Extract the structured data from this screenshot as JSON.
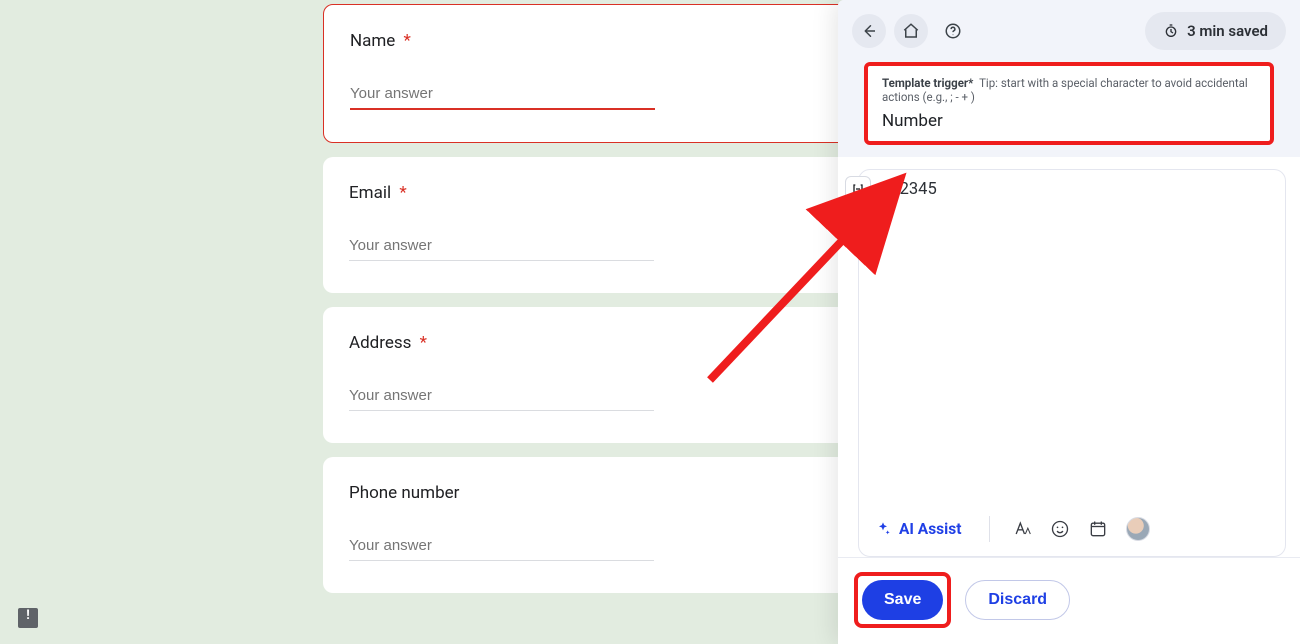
{
  "form": {
    "questions": [
      {
        "label": "Name",
        "required": true,
        "placeholder": "Your answer"
      },
      {
        "label": "Email",
        "required": true,
        "placeholder": "Your answer"
      },
      {
        "label": "Address",
        "required": true,
        "placeholder": "Your answer"
      },
      {
        "label": "Phone number",
        "required": false,
        "placeholder": "Your answer"
      }
    ]
  },
  "panel": {
    "saved_label": "3 min saved",
    "trigger": {
      "title": "Template trigger*",
      "tip": "Tip: start with a special character to avoid accidental actions (e.g., ; - + )",
      "value": "Number"
    },
    "editor": {
      "content": "O12345"
    },
    "toolbar": {
      "ai_assist_label": "AI Assist"
    },
    "footer": {
      "save_label": "Save",
      "discard_label": "Discard"
    }
  },
  "asterisk": "*"
}
